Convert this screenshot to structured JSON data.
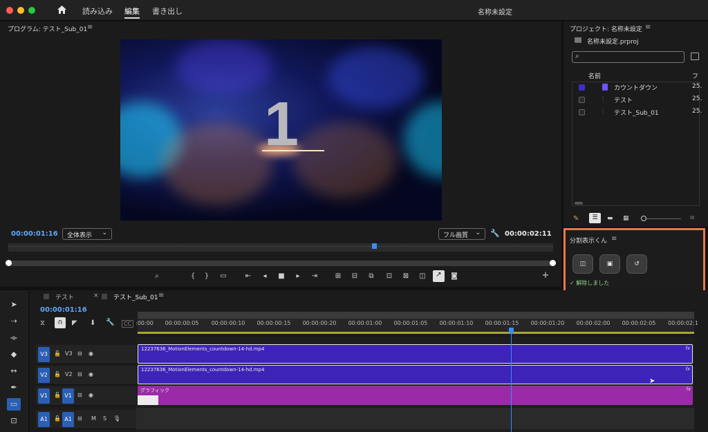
{
  "titlebar": {
    "tabs": [
      "読み込み",
      "編集",
      "書き出し"
    ],
    "active_tab": "編集",
    "project_title": "名称未設定"
  },
  "program": {
    "title": "プログラム: テスト_Sub_01",
    "frame_number": "1",
    "current_timecode": "00:00:01:16",
    "fit_dropdown": "全体表示",
    "quality_dropdown": "フル画質",
    "duration_timecode": "00:00:02:11"
  },
  "project": {
    "title": "プロジェクト: 名称未設定",
    "file": "名称未設定.prproj",
    "search_placeholder": "",
    "column_name": "名前",
    "column_fps": "フ",
    "items": [
      {
        "name": "カウントダウン",
        "fps": "25.",
        "icon": "sequence-icon",
        "color": "#3b2fc9"
      },
      {
        "name": "テスト",
        "fps": "25.",
        "icon": "sequence-icon",
        "color": "#666666"
      },
      {
        "name": "テスト_Sub_01",
        "fps": "25.",
        "icon": "sequence-icon",
        "color": "#666666"
      }
    ]
  },
  "extension": {
    "title": "分割表示くん",
    "status": "✓ 解除しました",
    "buttons": [
      "split-view-icon",
      "single-view-icon",
      "reset-icon"
    ]
  },
  "timeline": {
    "tabs": [
      "テスト",
      "テスト_Sub_01"
    ],
    "active_tab": "テスト_Sub_01",
    "current_timecode": "00:00:01:16",
    "ruler_labels": [
      ":00:00",
      "00:00:00:05",
      "00:00:00:10",
      "00:00:00:15",
      "00:00:00:20",
      "00:00:01:00",
      "00:00:01:05",
      "00:00:01:10",
      "00:00:01:15",
      "00:00:01:20",
      "00:00:02:00",
      "00:00:02:05",
      "00:00:02:1"
    ],
    "tracks": {
      "v3": {
        "tag": "V3",
        "label": "V3"
      },
      "v2": {
        "tag": "V2",
        "label": "V2"
      },
      "v1": {
        "tag": "V1",
        "label": "V1"
      },
      "a1": {
        "tag": "A1",
        "label": "A1",
        "m": "M",
        "s": "S"
      }
    },
    "clips": {
      "v3": "12237636_MotionElements_countdown-14-hd.mp4",
      "v2": "12237636_MotionElements_countdown-14-hd.mp4",
      "v1": "グラフィック",
      "fx": "fx"
    }
  },
  "colors": {
    "accent_blue": "#2a5fb5",
    "timecode_blue": "#5fa8ff",
    "video_clip": "#3d23b8",
    "graphic_clip": "#9b2aa8",
    "highlight_border": "#e9784e"
  }
}
